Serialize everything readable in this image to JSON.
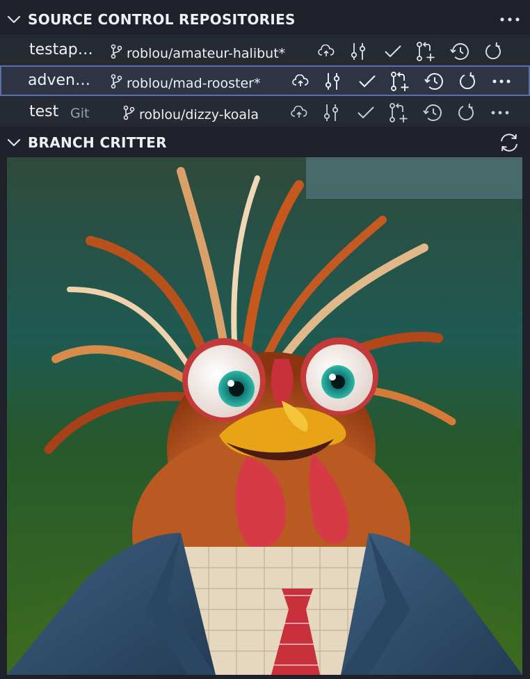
{
  "sections": {
    "repositories": {
      "title": "SOURCE CONTROL REPOSITORIES"
    },
    "critter": {
      "title": "BRANCH CRITTER"
    }
  },
  "repos": [
    {
      "name": "testap…",
      "provider": "",
      "branch": "roblou/amateur-halibut*",
      "selected": false
    },
    {
      "name": "adven…",
      "provider": "",
      "branch": "roblou/mad-rooster*",
      "selected": true
    },
    {
      "name": "test",
      "provider": "Git",
      "branch": "roblou/dizzy-koala",
      "selected": false
    }
  ],
  "icons": {
    "header_more": "ellipsis-icon",
    "branch": "git-branch-icon",
    "publish": "cloud-upload-icon",
    "stage": "source-control-icon",
    "commit": "check-icon",
    "pull_request": "git-pull-request-create-icon",
    "history": "history-icon",
    "refresh": "refresh-icon",
    "more": "ellipsis-icon",
    "critter_refresh": "sync-icon"
  },
  "colors": {
    "background": "#1e2129",
    "row": "#262a33",
    "row_selected": "#2f3444",
    "selected_border": "#5b6ea8",
    "text": "#eef0f5",
    "muted": "#9aa0ad"
  }
}
